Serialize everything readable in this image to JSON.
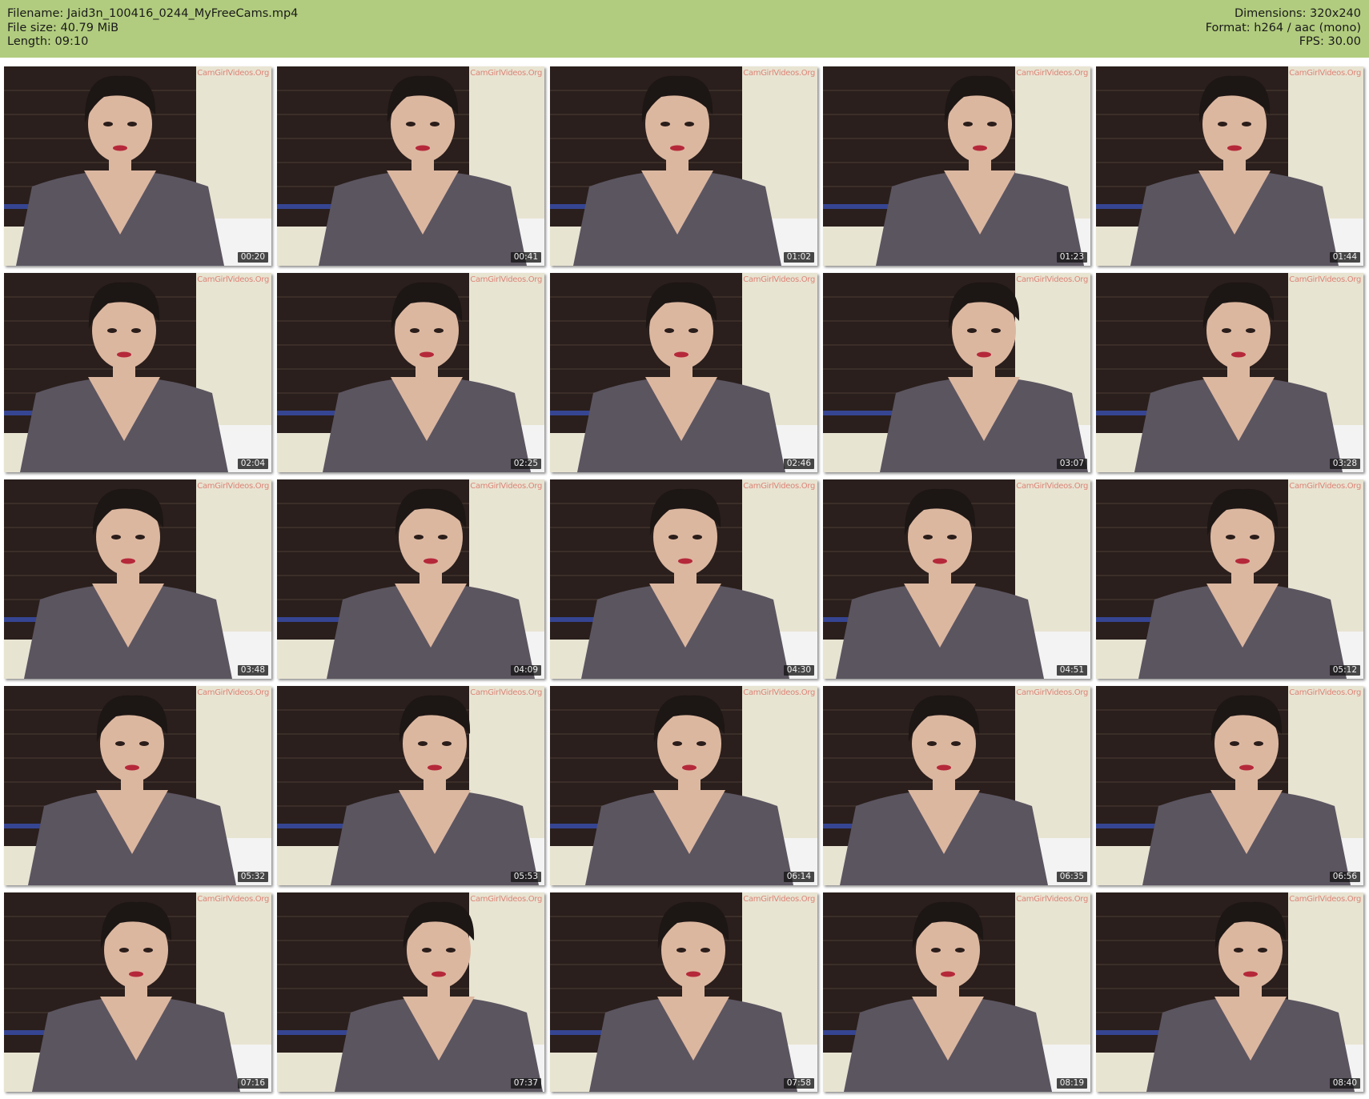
{
  "header": {
    "filename": "Filename: Jaid3n_100416_0244_MyFreeCams.mp4",
    "file_size": "File size: 40.79 MiB",
    "length": "Length: 09:10",
    "dimensions": "Dimensions: 320x240",
    "format": "Format: h264 / aac (mono)",
    "fps": "FPS: 30.00"
  },
  "watermark": "CamGirlVideos.Org",
  "colors": {
    "header_bg": "#b1cc7e",
    "curtain": "#2a1f1c",
    "wall": "#e8e4d2",
    "sweater": "#5b5560",
    "skin": "#dcb7a0",
    "hair": "#1c1614"
  },
  "thumbnails": [
    {
      "time": "00:20"
    },
    {
      "time": "00:41"
    },
    {
      "time": "01:02"
    },
    {
      "time": "01:23"
    },
    {
      "time": "01:44"
    },
    {
      "time": "02:04"
    },
    {
      "time": "02:25"
    },
    {
      "time": "02:46"
    },
    {
      "time": "03:07"
    },
    {
      "time": "03:28"
    },
    {
      "time": "03:48"
    },
    {
      "time": "04:09"
    },
    {
      "time": "04:30"
    },
    {
      "time": "04:51"
    },
    {
      "time": "05:12"
    },
    {
      "time": "05:32"
    },
    {
      "time": "05:53"
    },
    {
      "time": "06:14"
    },
    {
      "time": "06:35"
    },
    {
      "time": "06:56"
    },
    {
      "time": "07:16"
    },
    {
      "time": "07:37"
    },
    {
      "time": "07:58"
    },
    {
      "time": "08:19"
    },
    {
      "time": "08:40"
    }
  ]
}
